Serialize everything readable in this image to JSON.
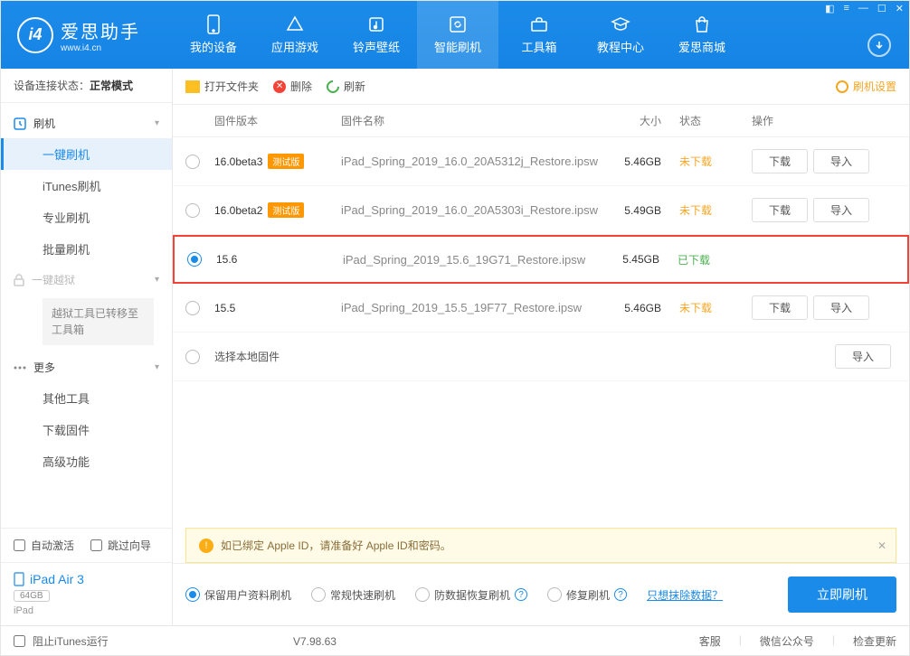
{
  "logo": {
    "title": "爱思助手",
    "subtitle": "www.i4.cn",
    "mark": "i4"
  },
  "nav": {
    "items": [
      {
        "label": "我的设备"
      },
      {
        "label": "应用游戏"
      },
      {
        "label": "铃声壁纸"
      },
      {
        "label": "智能刷机"
      },
      {
        "label": "工具箱"
      },
      {
        "label": "教程中心"
      },
      {
        "label": "爱思商城"
      }
    ]
  },
  "sidebar": {
    "conn_label": "设备连接状态：",
    "conn_status": "正常模式",
    "group_flash": "刷机",
    "items_flash": [
      "一键刷机",
      "iTunes刷机",
      "专业刷机",
      "批量刷机"
    ],
    "group_jailbreak": "一键越狱",
    "jailbreak_note": "越狱工具已转移至工具箱",
    "group_more": "更多",
    "items_more": [
      "其他工具",
      "下载固件",
      "高级功能"
    ],
    "auto_activate": "自动激活",
    "skip_guide": "跳过向导",
    "device_name": "iPad Air 3",
    "device_storage": "64GB",
    "device_type": "iPad"
  },
  "toolbar": {
    "open": "打开文件夹",
    "delete": "删除",
    "refresh": "刷新",
    "settings": "刷机设置"
  },
  "table": {
    "h_version": "固件版本",
    "h_name": "固件名称",
    "h_size": "大小",
    "h_status": "状态",
    "h_ops": "操作",
    "badge_beta": "测试版",
    "rows": [
      {
        "version": "16.0beta3",
        "beta": true,
        "name": "iPad_Spring_2019_16.0_20A5312j_Restore.ipsw",
        "size": "5.46GB",
        "status": "未下载",
        "downloaded": false,
        "selected": false,
        "highlighted": false,
        "show_ops": true
      },
      {
        "version": "16.0beta2",
        "beta": true,
        "name": "iPad_Spring_2019_16.0_20A5303i_Restore.ipsw",
        "size": "5.49GB",
        "status": "未下载",
        "downloaded": false,
        "selected": false,
        "highlighted": false,
        "show_ops": true
      },
      {
        "version": "15.6",
        "beta": false,
        "name": "iPad_Spring_2019_15.6_19G71_Restore.ipsw",
        "size": "5.45GB",
        "status": "已下载",
        "downloaded": true,
        "selected": true,
        "highlighted": true,
        "show_ops": false
      },
      {
        "version": "15.5",
        "beta": false,
        "name": "iPad_Spring_2019_15.5_19F77_Restore.ipsw",
        "size": "5.46GB",
        "status": "未下载",
        "downloaded": false,
        "selected": false,
        "highlighted": false,
        "show_ops": true
      }
    ],
    "local_fw": "选择本地固件",
    "btn_download": "下载",
    "btn_import": "导入"
  },
  "notice": "如已绑定 Apple ID，请准备好 Apple ID和密码。",
  "options": {
    "keep_data": "保留用户资料刷机",
    "normal": "常规快速刷机",
    "recovery": "防数据恢复刷机",
    "repair": "修复刷机",
    "erase_link": "只想抹除数据？",
    "flash_btn": "立即刷机"
  },
  "footer": {
    "block_itunes": "阻止iTunes运行",
    "version": "V7.98.63",
    "support": "客服",
    "wechat": "微信公众号",
    "update": "检查更新"
  }
}
